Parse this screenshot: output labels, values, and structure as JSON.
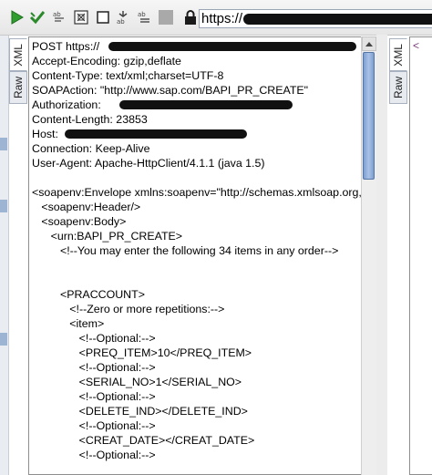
{
  "toolbar": {
    "url_prefix": "https://",
    "icons": [
      "run-icon",
      "submit-icon",
      "format-icon",
      "expand-icon",
      "stop-icon",
      "split-icon",
      "options-icon",
      "lock-icon"
    ],
    "colors": {
      "run": "#2f9d2f",
      "check": "#2c8a2c",
      "lock": "#1a1a1a"
    }
  },
  "left_tabs": {
    "xml": "XML",
    "raw": "Raw"
  },
  "right_tabs": {
    "xml": "XML",
    "raw": "Raw"
  },
  "right_pane": {
    "fragment": "<"
  },
  "request": {
    "lines": [
      "POST https://",
      "Accept-Encoding: gzip,deflate",
      "Content-Type: text/xml;charset=UTF-8",
      "SOAPAction: \"http://www.sap.com/BAPI_PR_CREATE\"",
      "Authorization:",
      "Content-Length: 23853",
      "Host:",
      "Connection: Keep-Alive",
      "User-Agent: Apache-HttpClient/4.1.1 (java 1.5)",
      "",
      "<soapenv:Envelope xmlns:soapenv=\"http://schemas.xmlsoap.org,",
      "   <soapenv:Header/>",
      "   <soapenv:Body>",
      "      <urn:BAPI_PR_CREATE>",
      "         <!--You may enter the following 34 items in any order-->",
      "",
      "",
      "         <PRACCOUNT>",
      "            <!--Zero or more repetitions:-->",
      "            <item>",
      "               <!--Optional:-->",
      "               <PREQ_ITEM>10</PREQ_ITEM>",
      "               <!--Optional:-->",
      "               <SERIAL_NO>1</SERIAL_NO>",
      "               <!--Optional:-->",
      "               <DELETE_IND></DELETE_IND>",
      "               <!--Optional:-->",
      "               <CREAT_DATE></CREAT_DATE>",
      "               <!--Optional:-->"
    ]
  }
}
